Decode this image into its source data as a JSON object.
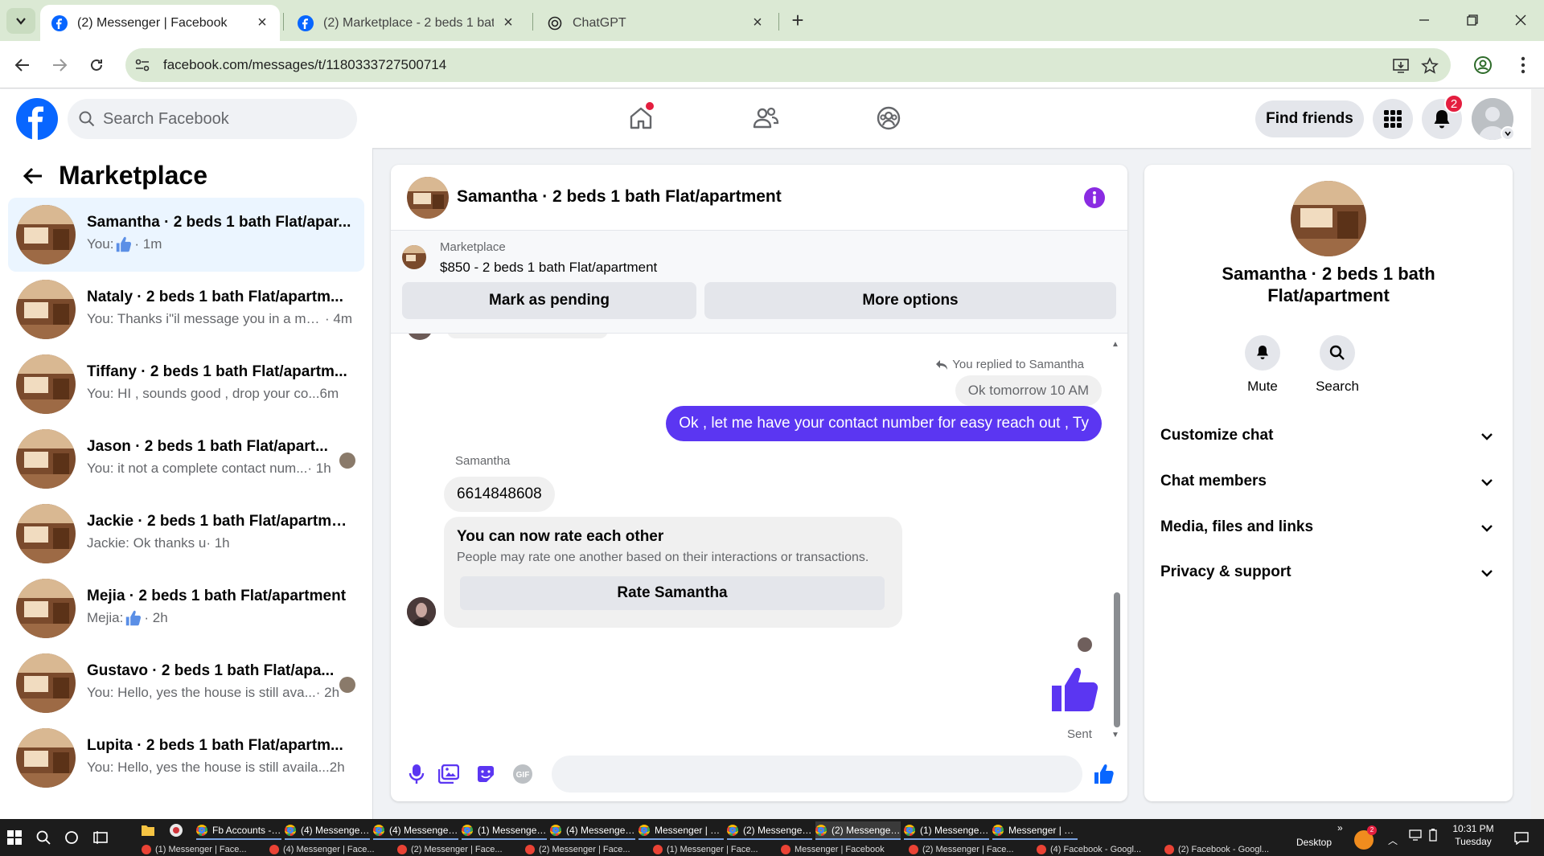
{
  "browser": {
    "tabs": [
      {
        "title": "(2) Messenger | Facebook",
        "active": true
      },
      {
        "title": "(2) Marketplace - 2 beds 1 bath",
        "active": false
      },
      {
        "title": "ChatGPT",
        "active": false
      }
    ],
    "url": "facebook.com/messages/t/1180333727500714"
  },
  "fb": {
    "search_placeholder": "Search Facebook",
    "find_friends": "Find friends",
    "notification_count": "2",
    "accent": "#0866ff",
    "brand_purple": "#5b36f2"
  },
  "left": {
    "title": "Marketplace",
    "conversations": [
      {
        "title": "Samantha · 2 beds 1 bath Flat/apar...",
        "preview": "You:",
        "has_like": true,
        "time": "· 1m",
        "active": true
      },
      {
        "title": "Nataly · 2 beds 1 bath Flat/apartm...",
        "preview": "You: Thanks i\"il message you in a mo...",
        "has_like": false,
        "time": " · 4m"
      },
      {
        "title": "Tiffany · 2 beds 1 bath Flat/apartm...",
        "preview": "You: HI , sounds good , drop your co...",
        "has_like": false,
        "time": " 6m"
      },
      {
        "title": "Jason · 2 beds 1 bath Flat/apart...",
        "preview": "You: it not a complete contact num...",
        "has_like": false,
        "time": " · 1h",
        "seen": true
      },
      {
        "title": "Jackie · 2 beds 1 bath Flat/apartme...",
        "preview": "Jackie: Ok thanks u",
        "has_like": false,
        "time": " · 1h"
      },
      {
        "title": "Mejia · 2 beds 1 bath Flat/apartment",
        "preview": "Mejia:",
        "has_like": true,
        "time": "· 2h"
      },
      {
        "title": "Gustavo · 2 beds 1 bath Flat/apa...",
        "preview": "You: Hello, yes the house is still ava...",
        "has_like": false,
        "time": " · 2h",
        "seen": true
      },
      {
        "title": "Lupita · 2 beds 1 bath Flat/apartm...",
        "preview": "You: Hello, yes the house is still availa...",
        "has_like": false,
        "time": " 2h"
      }
    ]
  },
  "chat": {
    "header_name": "Samantha · 2 beds 1 bath Flat/apartment",
    "marketplace_label": "Marketplace",
    "listing": "$850 - 2 beds 1 bath Flat/apartment",
    "mark_pending": "Mark as pending",
    "more_options": "More options",
    "reply_note": "You replied to Samantha",
    "quoted": "Ok tomorrow 10 AM",
    "outgoing": "Ok , let me have your contact number for easy reach out , Ty",
    "sender": "Samantha",
    "incoming": "6614848608",
    "rate_title": "You can now rate each other",
    "rate_sub": "People may rate one another based on their interactions or transactions.",
    "rate_button": "Rate Samantha",
    "sent": "Sent"
  },
  "info": {
    "name": "Samantha · 2 beds 1 bath Flat/apartment",
    "actions": [
      "Mute",
      "Search"
    ],
    "sections": [
      "Customize chat",
      "Chat members",
      "Media, files and links",
      "Privacy & support"
    ]
  },
  "taskbar": {
    "row1": [
      "Fb Accounts - G...",
      "(4) Messenger | F...",
      "(4) Messenger | F...",
      "(1) Messenger | F...",
      "(4) Messenger | F...",
      "Messenger | Face...",
      "(2) Messenger | F...",
      "(2) Messenger | F...",
      "(1) Messenger | F...",
      "Messenger | Face..."
    ],
    "row2": [
      "(1) Messenger | Face...",
      "(4) Messenger | Face...",
      "(2) Messenger | Face...",
      "(2) Messenger | Face...",
      "(1) Messenger | Face...",
      "Messenger | Facebook",
      "(2) Messenger | Face...",
      "(4) Facebook - Googl...",
      "(2) Facebook - Googl..."
    ],
    "desktop": "Desktop",
    "time": "10:31 PM",
    "day": "Tuesday"
  }
}
